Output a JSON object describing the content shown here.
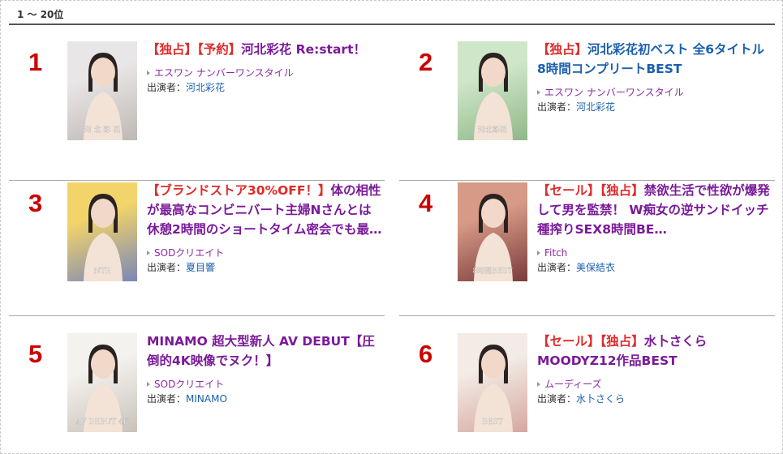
{
  "header": {
    "range_label": "1 〜 20位"
  },
  "actress_prefix": "出演者：",
  "items": [
    {
      "rank": "1",
      "title_parts": [
        {
          "text": "【独占】",
          "tag": true
        },
        {
          "text": "【予約】",
          "tag": true
        },
        {
          "text": "河北彩花 Re:start！",
          "tag": false
        }
      ],
      "title_color": "purple",
      "maker": "エスワン ナンバーワンスタイル",
      "actress": "河北彩花",
      "thumb_text": "河 北 彩 花",
      "thumb_colors": [
        "#e8e6e6",
        "#bfb8b4"
      ]
    },
    {
      "rank": "2",
      "title_parts": [
        {
          "text": "【独占】",
          "tag": true
        },
        {
          "text": "河北彩花初ベスト 全6タイトル8時間コンプリートBEST",
          "tag": false
        }
      ],
      "title_color": "blue",
      "maker": "エスワン ナンバーワンスタイル",
      "actress": "河北彩花",
      "thumb_text": "河北彩花",
      "thumb_colors": [
        "#cfe6c8",
        "#8fb889"
      ]
    },
    {
      "rank": "3",
      "title_parts": [
        {
          "text": "【ブランドストア30%OFF！】",
          "tag": true
        },
        {
          "text": "体の相性が最高なコンビニバート主婦Nさんとは休憩2時間のショートタイム密会でも最…",
          "tag": false
        }
      ],
      "title_color": "purple",
      "maker": "SODクリエイト",
      "actress": "夏目響",
      "thumb_text": "NTR",
      "thumb_colors": [
        "#f2d46a",
        "#7a86b8"
      ]
    },
    {
      "rank": "4",
      "title_parts": [
        {
          "text": "【セール】",
          "tag": true
        },
        {
          "text": "【独占】",
          "tag": true
        },
        {
          "text": "禁欲生活で性欲が爆発して男を監禁！ W痴女の逆サンドイッチ種搾りSEX8時間BE…",
          "tag": false
        }
      ],
      "title_color": "purple",
      "maker": "Fitch",
      "actress": "美保結衣",
      "thumb_text": "8時間BEST",
      "thumb_colors": [
        "#d69a86",
        "#7a3b3b"
      ]
    },
    {
      "rank": "5",
      "title_parts": [
        {
          "text": "MINAMO 超大型新人 AV DEBUT【圧倒的4K映像でヌク！】",
          "tag": false
        }
      ],
      "title_color": "purple",
      "maker": "SODクリエイト",
      "actress": "MINAMO",
      "thumb_text": "AV DEBUT 4K",
      "thumb_colors": [
        "#f4f2ef",
        "#c9c2ba"
      ]
    },
    {
      "rank": "6",
      "title_parts": [
        {
          "text": "【セール】",
          "tag": true
        },
        {
          "text": "【独占】",
          "tag": true
        },
        {
          "text": "水卜さくらMOODYZ12作品BEST",
          "tag": false
        }
      ],
      "title_color": "purple",
      "maker": "ムーディーズ",
      "actress": "水卜さくら",
      "thumb_text": "BEST",
      "thumb_colors": [
        "#f3ece6",
        "#d6a7a0"
      ]
    }
  ]
}
